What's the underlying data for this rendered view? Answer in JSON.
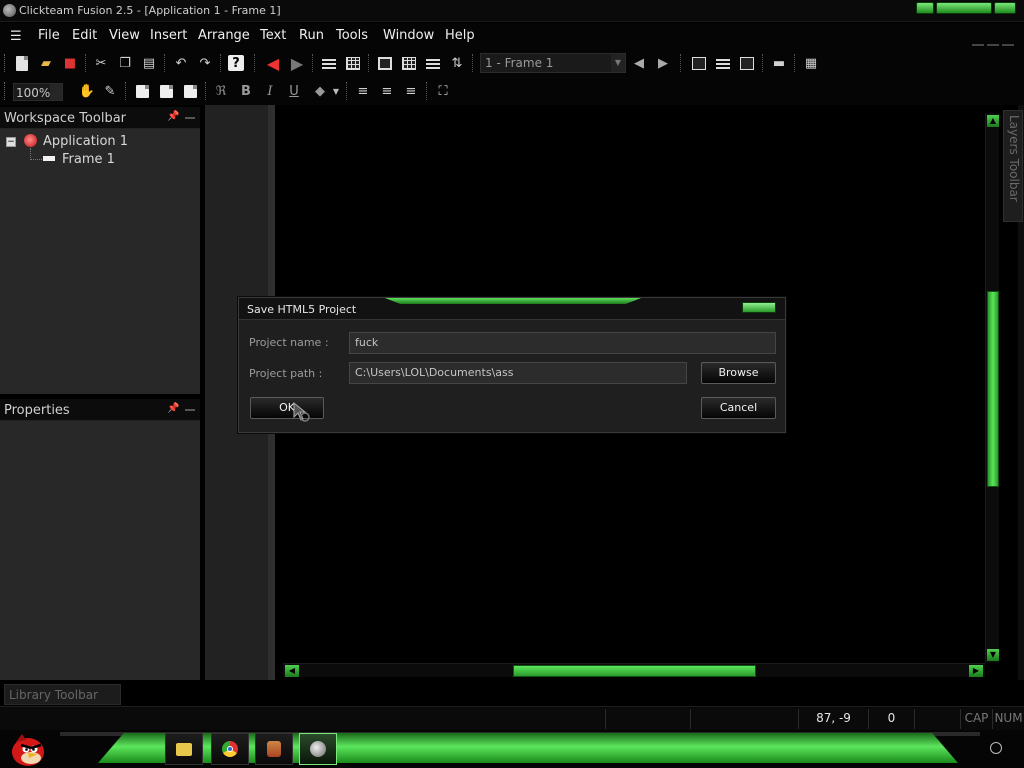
{
  "window": {
    "title": "Clickteam Fusion 2.5 - [Application 1 - Frame 1]"
  },
  "menu": {
    "items": [
      "File",
      "Edit",
      "View",
      "Insert",
      "Arrange",
      "Text",
      "Run",
      "Tools",
      "Window",
      "Help"
    ]
  },
  "toolbar": {
    "frame_select": "1 - Frame 1",
    "zoom": "100%",
    "text_bold": "B",
    "text_italic": "I",
    "text_underline": "U"
  },
  "workspace": {
    "title": "Workspace Toolbar",
    "tree": {
      "toggle": "−",
      "application": "Application 1",
      "frame": "Frame 1"
    }
  },
  "properties": {
    "title": "Properties"
  },
  "library": {
    "title": "Library Toolbar"
  },
  "layers": {
    "title": "Layers Toolbar"
  },
  "dialog": {
    "title": "Save HTML5 Project",
    "project_name_label": "Project name :",
    "project_name_value": "fuck",
    "project_path_label": "Project path :",
    "project_path_value": "C:\\Users\\LOL\\Documents\\ass",
    "browse_label": "Browse",
    "ok_label": "OK",
    "cancel_label": "Cancel"
  },
  "statusbar": {
    "coords": "87, -9",
    "value": "0",
    "caps": "CAP",
    "num": "NUM"
  },
  "colors": {
    "accent_green": "#5ce65c",
    "background": "#000000",
    "panel": "#282828"
  },
  "icons": {
    "taskbar": [
      "start-angry-bird-icon",
      "folder-icon",
      "chrome-icon",
      "game-icon",
      "clickteam-icon"
    ]
  }
}
